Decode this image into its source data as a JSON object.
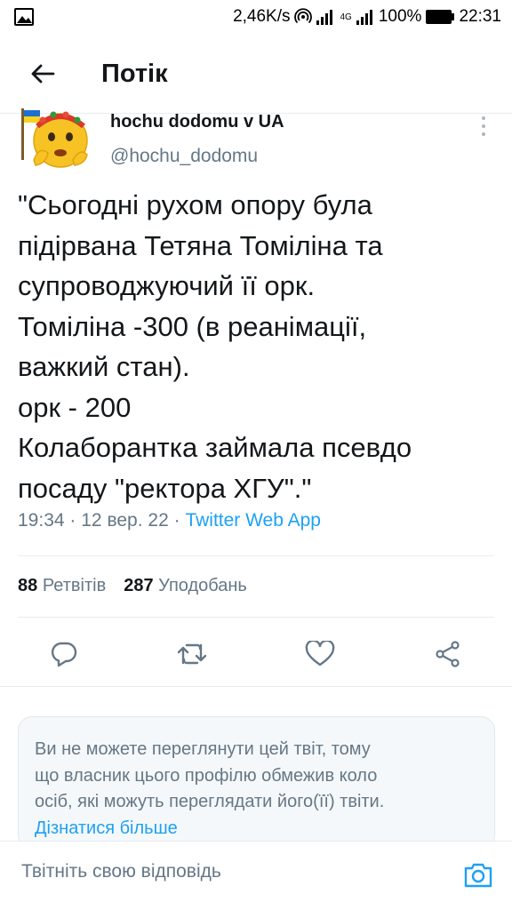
{
  "status_bar": {
    "speed": "2,46K/s",
    "network_label": "4G",
    "battery": "100%",
    "time": "22:31"
  },
  "header": {
    "title": "Потік",
    "back_icon": "arrow-left-icon"
  },
  "tweet": {
    "author_name": "hochu dodomu v UA",
    "author_handle": "@hochu_dodomu",
    "text_lines": [
      "\"Сьогодні рухом опору була",
      "підірвана Тетяна Томіліна та",
      "супроводжуючий її орк.",
      "Томіліна -300 (в реанімації,",
      "важкий стан).",
      "орк - 200",
      "Колаборантка займала псевдо",
      "посаду \"ректора ХГУ\".\""
    ],
    "time": "19:34",
    "date": "12 вер. 22",
    "separator": "·",
    "source": "Twitter Web App",
    "retweets_count": "88",
    "retweets_label": "Ретвітів",
    "likes_count": "287",
    "likes_label": "Уподобань"
  },
  "actions": {
    "reply_icon": "reply-icon",
    "retweet_icon": "retweet-icon",
    "like_icon": "heart-icon",
    "share_icon": "share-icon"
  },
  "notice": {
    "lines": [
      "Ви не можете переглянути цей твіт, тому",
      "що власник цього профілю обмежив коло",
      "осіб, які можуть переглядати його(її) твіти."
    ],
    "link": "Дізнатися більше"
  },
  "reply": {
    "placeholder": "Твітніть свою відповідь",
    "camera_icon": "camera-icon"
  },
  "colors": {
    "accent": "#1da1f2",
    "text_primary": "#14171a",
    "text_secondary": "#657786",
    "divider": "#e6ecf0"
  }
}
